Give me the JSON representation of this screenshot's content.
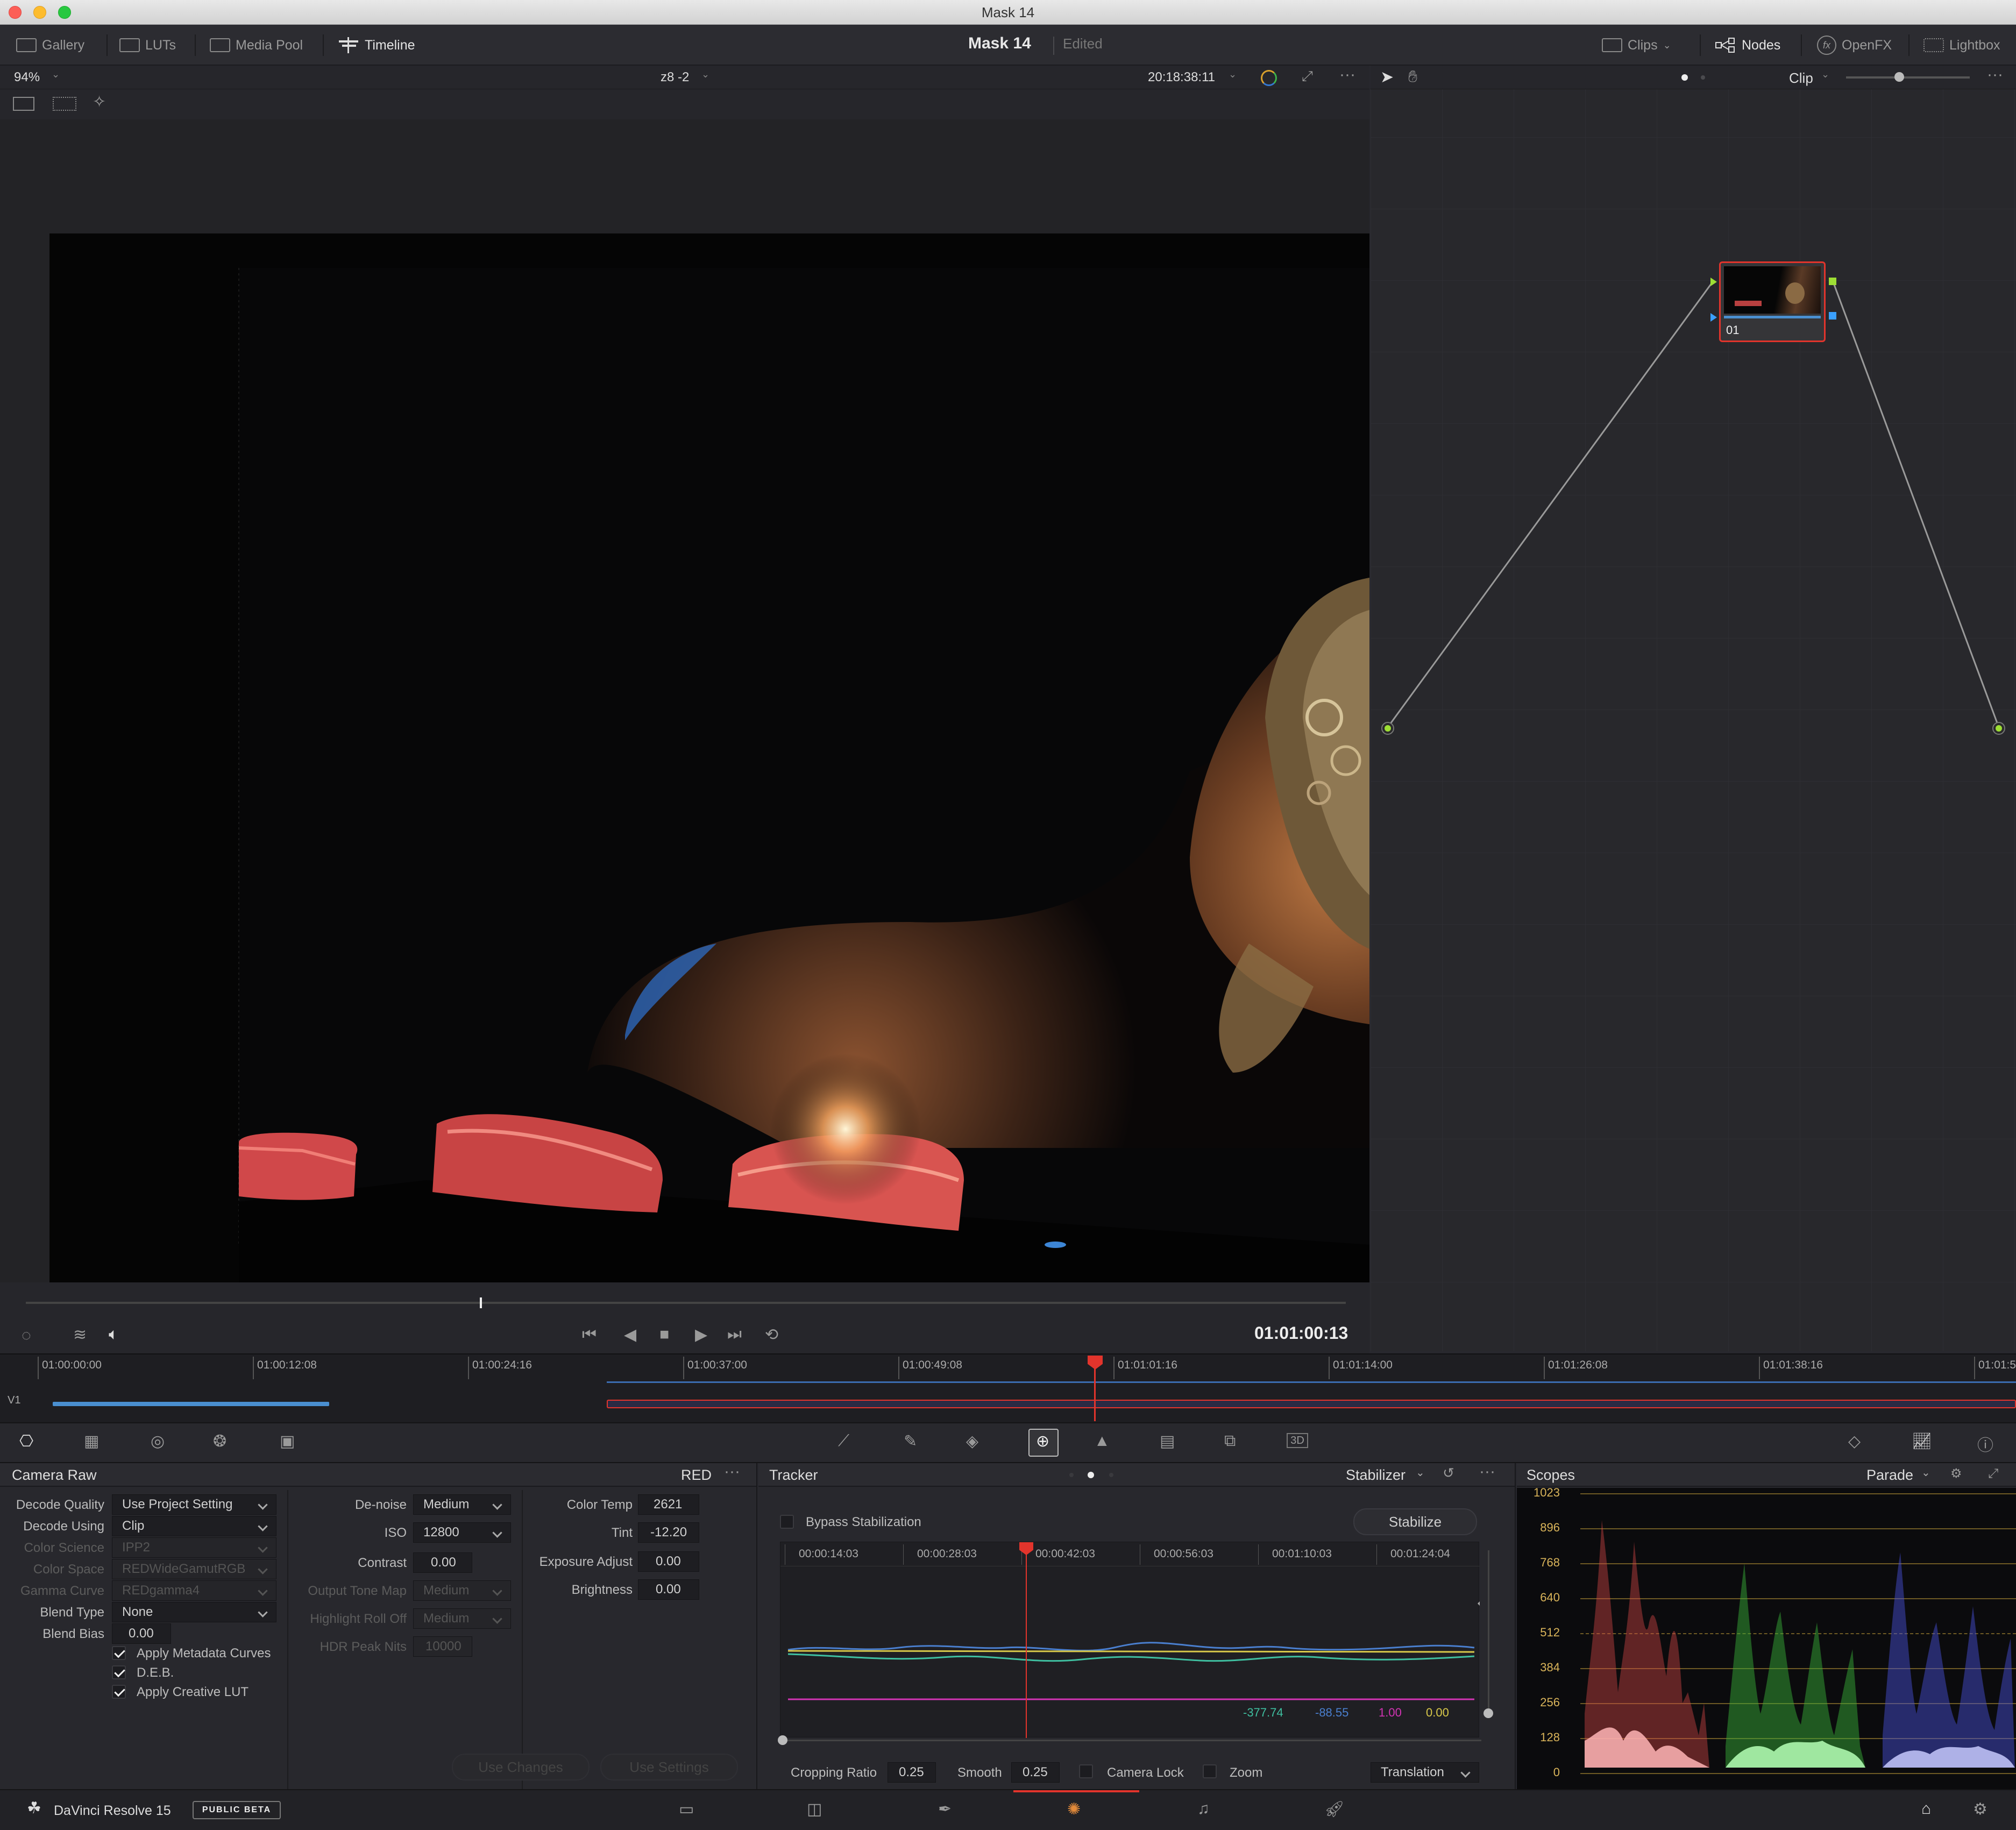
{
  "window": {
    "title": "Mask 14"
  },
  "topbar": {
    "gallery": "Gallery",
    "luts": "LUTs",
    "media_pool": "Media Pool",
    "timeline": "Timeline",
    "project_title": "Mask 14",
    "project_status": "Edited",
    "clips": "Clips",
    "nodes": "Nodes",
    "openfx": "OpenFX",
    "lightbox": "Lightbox"
  },
  "viewer": {
    "zoom": "94%",
    "clip_name": "z8 -2",
    "source_timecode": "20:18:38:11",
    "record_timecode": "01:01:00:13"
  },
  "nodes": {
    "mode": "Clip",
    "node_label": "01"
  },
  "timeline": {
    "track": "V1",
    "ticks": [
      "01:00:00:00",
      "01:00:12:08",
      "01:00:24:16",
      "01:00:37:00",
      "01:00:49:08",
      "01:01:01:16",
      "01:01:14:00",
      "01:01:26:08",
      "01:01:38:16",
      "01:01:5"
    ]
  },
  "camera_raw": {
    "title": "Camera Raw",
    "format": "RED",
    "decode_quality_label": "Decode Quality",
    "decode_quality": "Use Project Setting",
    "decode_using_label": "Decode Using",
    "decode_using": "Clip",
    "color_science_label": "Color Science",
    "color_science": "IPP2",
    "color_space_label": "Color Space",
    "color_space": "REDWideGamutRGB",
    "gamma_curve_label": "Gamma Curve",
    "gamma_curve": "REDgamma4",
    "blend_type_label": "Blend Type",
    "blend_type": "None",
    "blend_bias_label": "Blend Bias",
    "blend_bias": "0.00",
    "apply_metadata_curves": "Apply Metadata Curves",
    "deb": "D.E.B.",
    "apply_creative_lut": "Apply Creative LUT",
    "denoise_label": "De-noise",
    "denoise": "Medium",
    "iso_label": "ISO",
    "iso": "12800",
    "contrast_label": "Contrast",
    "contrast": "0.00",
    "output_tone_map_label": "Output Tone Map",
    "output_tone_map": "Medium",
    "highlight_rolloff_label": "Highlight Roll Off",
    "highlight_rolloff": "Medium",
    "hdr_peak_nits_label": "HDR Peak Nits",
    "hdr_peak_nits": "10000",
    "color_temp_label": "Color Temp",
    "color_temp": "2621",
    "tint_label": "Tint",
    "tint": "-12.20",
    "exposure_adjust_label": "Exposure Adjust",
    "exposure_adjust": "0.00",
    "brightness_label": "Brightness",
    "brightness": "0.00",
    "use_changes": "Use Changes",
    "use_settings": "Use Settings"
  },
  "tracker": {
    "title": "Tracker",
    "mode": "Stabilizer",
    "bypass_label": "Bypass Stabilization",
    "stabilize_button": "Stabilize",
    "ticks": [
      "00:00:14:03",
      "00:00:28:03",
      "00:00:42:03",
      "00:00:56:03",
      "00:01:10:03",
      "00:01:24:04"
    ],
    "readouts": [
      "-377.74",
      "-88.55",
      "1.00",
      "0.00"
    ],
    "cropping_ratio_label": "Cropping Ratio",
    "cropping_ratio": "0.25",
    "smooth_label": "Smooth",
    "smooth": "0.25",
    "camera_lock_label": "Camera Lock",
    "zoom_label": "Zoom",
    "translation": "Translation"
  },
  "scopes": {
    "title": "Scopes",
    "mode": "Parade",
    "scale": [
      "1023",
      "896",
      "768",
      "640",
      "512",
      "384",
      "256",
      "128",
      "0"
    ]
  },
  "status": {
    "app_name": "DaVinci Resolve 15",
    "badge": "PUBLIC BETA"
  },
  "colors": {
    "accent_red": "#e2342c",
    "panel": "#28282d",
    "accent_blue": "#4a8fd0"
  }
}
